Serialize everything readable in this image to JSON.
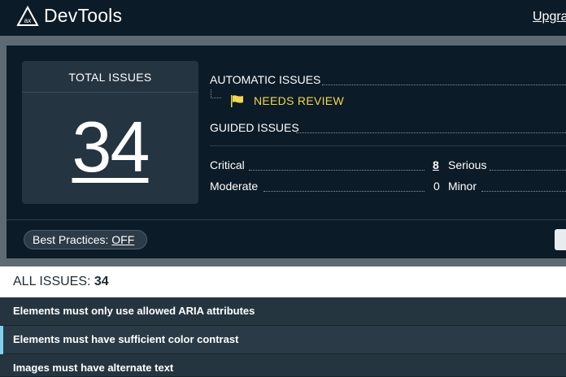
{
  "header": {
    "app_title": "DevTools",
    "logo_icon": "axe-logo-icon",
    "upgrade_label": "Upgra"
  },
  "summary": {
    "total_title": "TOTAL ISSUES",
    "total_count": "34",
    "automatic_label": "AUTOMATIC ISSUES",
    "needs_review_label": "NEEDS REVIEW",
    "guided_label": "GUIDED ISSUES",
    "critical_label": "Critical",
    "critical_count": "8",
    "serious_label": "Serious",
    "moderate_label": "Moderate",
    "moderate_count": "0",
    "minor_label": "Minor",
    "best_practices_label": "Best Practices: ",
    "best_practices_value": "OFF"
  },
  "issues": {
    "header_label": "ALL ISSUES: ",
    "header_count": "34",
    "items": [
      {
        "label": "Elements must only use allowed ARIA attributes",
        "selected": false
      },
      {
        "label": "Elements must have sufficient color contrast",
        "selected": true
      },
      {
        "label": "Images must have alternate text",
        "selected": false
      }
    ]
  },
  "colors": {
    "background": "#0b1b27",
    "card": "#243440",
    "needs_review": "#f2d74f",
    "accent": "#7fd1f0"
  }
}
